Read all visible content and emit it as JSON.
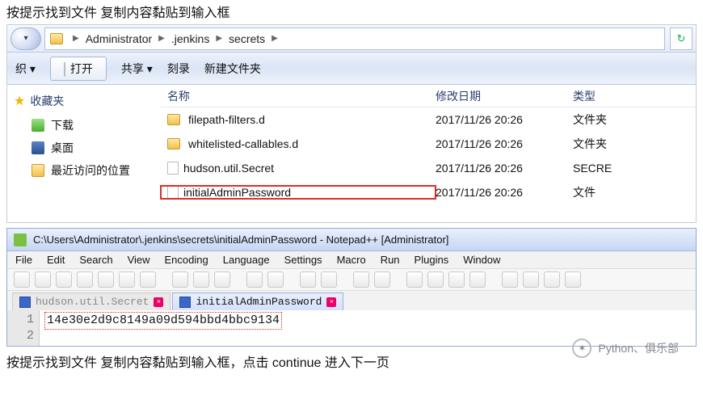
{
  "instructions": {
    "top": "按提示找到文件 复制内容黏贴到输入框",
    "bottom": "按提示找到文件 复制内容黏贴到输入框，点击 continue 进入下一页"
  },
  "explorer": {
    "breadcrumb": [
      "Administrator",
      ".jenkins",
      "secrets"
    ],
    "toolbar": {
      "organize": "织 ▾",
      "open": "打开",
      "share": "共享 ▾",
      "burn": "刻录",
      "newfolder": "新建文件夹"
    },
    "columns": {
      "name": "名称",
      "modified": "修改日期",
      "type": "类型"
    },
    "sidebar": {
      "favorites": "收藏夹",
      "items": [
        {
          "label": "下载"
        },
        {
          "label": "桌面"
        },
        {
          "label": "最近访问的位置"
        }
      ]
    },
    "files": [
      {
        "name": "filepath-filters.d",
        "modified": "2017/11/26 20:26",
        "type": "文件夹",
        "kind": "folder"
      },
      {
        "name": "whitelisted-callables.d",
        "modified": "2017/11/26 20:26",
        "type": "文件夹",
        "kind": "folder"
      },
      {
        "name": "hudson.util.Secret",
        "modified": "2017/11/26 20:26",
        "type": "SECRE",
        "kind": "file"
      },
      {
        "name": "initialAdminPassword",
        "modified": "2017/11/26 20:26",
        "type": "文件",
        "kind": "file",
        "highlighted": true
      }
    ]
  },
  "npp": {
    "title": "C:\\Users\\Administrator\\.jenkins\\secrets\\initialAdminPassword - Notepad++ [Administrator]",
    "menu": [
      "File",
      "Edit",
      "Search",
      "View",
      "Encoding",
      "Language",
      "Settings",
      "Macro",
      "Run",
      "Plugins",
      "Window"
    ],
    "tabs": [
      {
        "label": "hudson.util.Secret",
        "active": false
      },
      {
        "label": "initialAdminPassword",
        "active": true
      }
    ],
    "content": "14e30e2d9c8149a09d594bbd4bbc9134"
  },
  "watermark": "Python、俱乐部"
}
